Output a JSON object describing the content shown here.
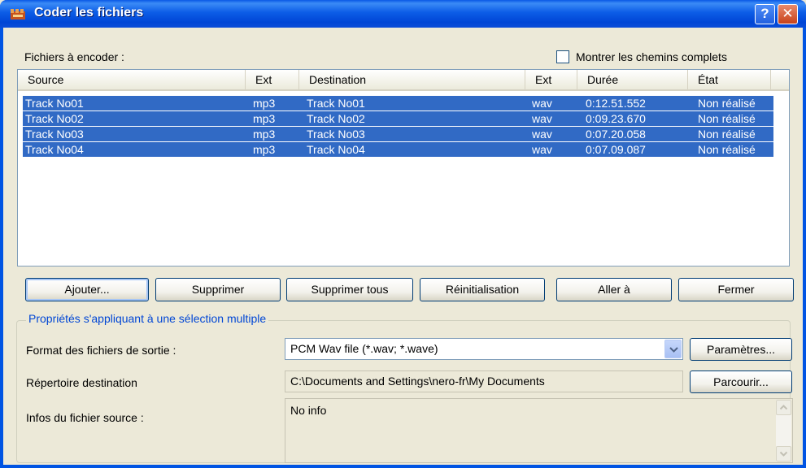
{
  "window": {
    "title": "Coder les fichiers",
    "help_label": "?",
    "close_label": "✕"
  },
  "files_label": "Fichiers à encoder :",
  "show_paths": {
    "label": "Montrer les chemins complets",
    "checked": false
  },
  "list": {
    "headers": [
      "Source",
      "Ext",
      "Destination",
      "Ext",
      "Durée",
      "État"
    ],
    "rows": [
      {
        "source": "Track No01",
        "ext": "mp3",
        "destination": "Track No01",
        "dest_ext": "wav",
        "duration": "0:12.51.552",
        "state": "Non réalisé"
      },
      {
        "source": "Track No02",
        "ext": "mp3",
        "destination": "Track No02",
        "dest_ext": "wav",
        "duration": "0:09.23.670",
        "state": "Non réalisé"
      },
      {
        "source": "Track No03",
        "ext": "mp3",
        "destination": "Track No03",
        "dest_ext": "wav",
        "duration": "0:07.20.058",
        "state": "Non réalisé"
      },
      {
        "source": "Track No04",
        "ext": "mp3",
        "destination": "Track No04",
        "dest_ext": "wav",
        "duration": "0:07.09.087",
        "state": "Non réalisé"
      }
    ],
    "selection_color": "#316ac5"
  },
  "buttons": {
    "add": "Ajouter...",
    "remove": "Supprimer",
    "remove_all": "Supprimer tous",
    "reset": "Réinitialisation",
    "goto": "Aller à",
    "close": "Fermer"
  },
  "properties": {
    "group_title": "Propriétés s'appliquant à une sélection multiple",
    "format_label": "Format des fichiers de sortie :",
    "format_value": "PCM Wav file (*.wav; *.wave)",
    "params_button": "Paramètres...",
    "dest_label": "Répertoire destination",
    "dest_value": "C:\\Documents and Settings\\nero-fr\\My Documents",
    "browse_button": "Parcourir...",
    "source_info_label": "Infos du fichier source :",
    "source_info_value": "No info"
  },
  "colors": {
    "titlebar": "#0054e3",
    "group_title": "#0046d5",
    "dialog_bg": "#ece9d8"
  }
}
